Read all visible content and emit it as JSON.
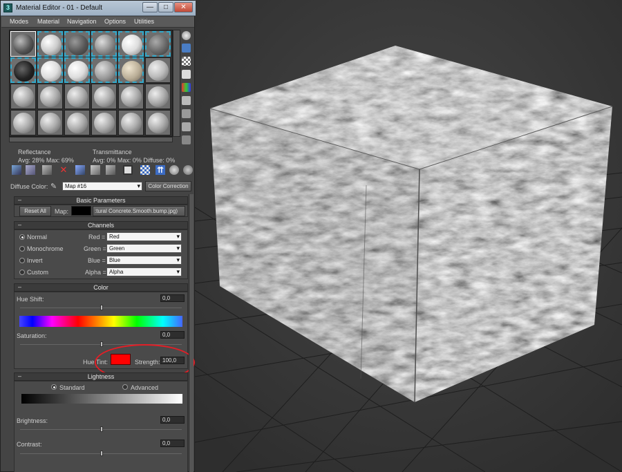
{
  "window": {
    "title": "Material Editor - 01 - Default",
    "app_icon_glyph": "3",
    "min_glyph": "—",
    "max_glyph": "□",
    "close_glyph": "✕"
  },
  "menu": [
    "Modes",
    "Material",
    "Navigation",
    "Options",
    "Utilities"
  ],
  "reflectance": {
    "title": "Reflectance",
    "avg_max": "Avg: 28% Max: 69%"
  },
  "transmittance": {
    "title": "Transmittance",
    "values": "Avg: 0% Max: 0% Diffuse: 0%"
  },
  "diffuse": {
    "label": "Diffuse Color:",
    "map_value": "Map #16",
    "color_correction": "Color Correction"
  },
  "basic_parameters": {
    "title": "Basic Parameters",
    "reset_all": "Reset All",
    "map_label": "Map:",
    "map_file": ":tural Concrete.Smooth.bump.jpg)"
  },
  "channels": {
    "title": "Channels",
    "modes": [
      {
        "label": "Normal",
        "selected": true
      },
      {
        "label": "Monochrome",
        "selected": false
      },
      {
        "label": "Invert",
        "selected": false
      },
      {
        "label": "Custom",
        "selected": false
      }
    ],
    "assignments": [
      {
        "label": "Red =",
        "value": "Red"
      },
      {
        "label": "Green =",
        "value": "Green"
      },
      {
        "label": "Blue =",
        "value": "Blue"
      },
      {
        "label": "Alpha =",
        "value": "Alpha"
      }
    ]
  },
  "color": {
    "title": "Color",
    "hue_shift_label": "Hue Shift:",
    "hue_shift_value": "0,0",
    "saturation_label": "Saturation:",
    "saturation_value": "0,0",
    "hue_tint_label": "Hue Tint:",
    "hue_tint_color": "#ff0000",
    "strength_label": "Strength:",
    "strength_value": "100,0"
  },
  "lightness": {
    "title": "Lightness",
    "standard": "Standard",
    "advanced": "Advanced",
    "brightness_label": "Brightness:",
    "brightness_value": "0,0",
    "contrast_label": "Contrast:",
    "contrast_value": "0,0"
  },
  "colors": {
    "accent_annotation": "#e41e26",
    "viewport_bg": "#3a3a3a"
  }
}
